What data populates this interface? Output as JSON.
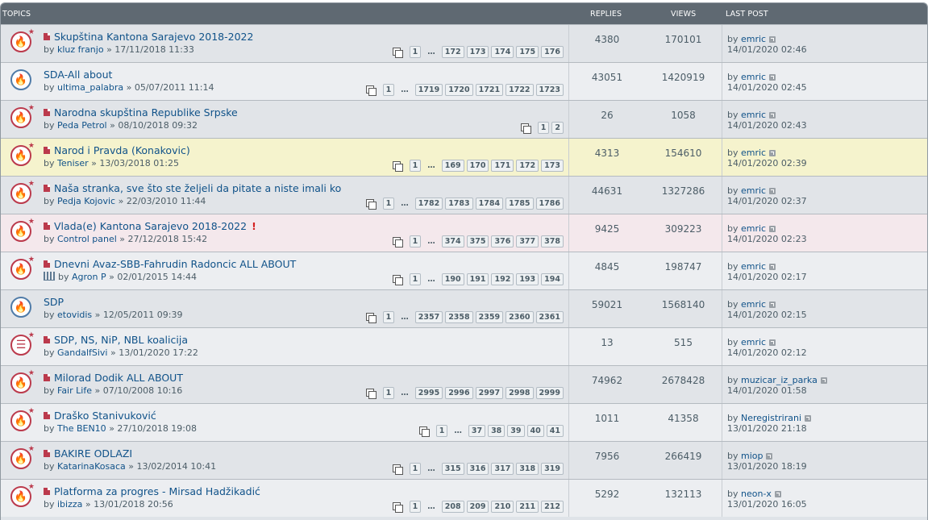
{
  "header": {
    "topics": "TOPICS",
    "replies": "REPLIES",
    "views": "VIEWS",
    "last_post": "LAST POST"
  },
  "topics": [
    {
      "title": "Skupština Kantona Sarajevo 2018-2022",
      "by": "by",
      "author": "kluz franjo",
      "date": "» 17/11/2018 11:33",
      "replies": "4380",
      "views": "170101",
      "last_by": "by",
      "last_author": "emric",
      "last_date": "14/01/2020 02:46",
      "pages": [
        "1",
        "…",
        "172",
        "173",
        "174",
        "175",
        "176"
      ],
      "icon": "hot-unread-icon",
      "state": "normal",
      "marker": true
    },
    {
      "title": "SDA-All about",
      "by": "by",
      "author": "ultima_palabra",
      "date": "» 05/07/2011 11:14",
      "replies": "43051",
      "views": "1420919",
      "last_by": "by",
      "last_author": "emric",
      "last_date": "14/01/2020 02:45",
      "pages": [
        "1",
        "…",
        "1719",
        "1720",
        "1721",
        "1722",
        "1723"
      ],
      "icon": "hot-read-icon",
      "state": "alt",
      "marker": false
    },
    {
      "title": "Narodna skupština Republike Srpske",
      "by": "by",
      "author": "Peda Petrol",
      "date": "» 08/10/2018 09:32",
      "replies": "26",
      "views": "1058",
      "last_by": "by",
      "last_author": "emric",
      "last_date": "14/01/2020 02:43",
      "pages": [
        "1",
        "2"
      ],
      "icon": "hot-unread-icon",
      "state": "normal",
      "marker": true
    },
    {
      "title": "Narod i Pravda (Konakovic)",
      "by": "by",
      "author": "Teniser",
      "date": "» 13/03/2018 01:25",
      "replies": "4313",
      "views": "154610",
      "last_by": "by",
      "last_author": "emric",
      "last_date": "14/01/2020 02:39",
      "pages": [
        "1",
        "…",
        "169",
        "170",
        "171",
        "172",
        "173"
      ],
      "icon": "hot-unread-icon",
      "state": "sticky",
      "marker": true
    },
    {
      "title": "Naša stranka, sve što ste željeli da pitate a niste imali ko",
      "by": "by",
      "author": "Pedja Kojovic",
      "date": "» 22/03/2010 11:44",
      "replies": "44631",
      "views": "1327286",
      "last_by": "by",
      "last_author": "emric",
      "last_date": "14/01/2020 02:37",
      "pages": [
        "1",
        "…",
        "1782",
        "1783",
        "1784",
        "1785",
        "1786"
      ],
      "icon": "hot-unread-icon",
      "state": "normal",
      "marker": true
    },
    {
      "title": "Vlada(e) Kantona Sarajevo 2018-2022",
      "by": "by",
      "author": "Control panel",
      "date": "» 27/12/2018 15:42",
      "replies": "9425",
      "views": "309223",
      "last_by": "by",
      "last_author": "emric",
      "last_date": "14/01/2020 02:23",
      "pages": [
        "1",
        "…",
        "374",
        "375",
        "376",
        "377",
        "378"
      ],
      "icon": "hot-unread-icon",
      "state": "reported",
      "marker": true,
      "reported_mark": "!"
    },
    {
      "title": "Dnevni Avaz-SBB-Fahrudin Radoncic ALL ABOUT",
      "by": "by",
      "author": "Agron P",
      "date": "» 02/01/2015 14:44",
      "replies": "4845",
      "views": "198747",
      "last_by": "by",
      "last_author": "emric",
      "last_date": "14/01/2020 02:17",
      "pages": [
        "1",
        "…",
        "190",
        "191",
        "192",
        "193",
        "194"
      ],
      "icon": "hot-unread-icon",
      "state": "alt",
      "marker": true,
      "poll": true
    },
    {
      "title": "SDP",
      "by": "by",
      "author": "etovidis",
      "date": "» 12/05/2011 09:39",
      "replies": "59021",
      "views": "1568140",
      "last_by": "by",
      "last_author": "emric",
      "last_date": "14/01/2020 02:15",
      "pages": [
        "1",
        "…",
        "2357",
        "2358",
        "2359",
        "2360",
        "2361"
      ],
      "icon": "hot-read-icon",
      "state": "normal",
      "marker": false
    },
    {
      "title": "SDP, NS, NiP, NBL koalicija",
      "by": "by",
      "author": "GandalfSivi",
      "date": "» 13/01/2020 17:22",
      "replies": "13",
      "views": "515",
      "last_by": "by",
      "last_author": "emric",
      "last_date": "14/01/2020 02:12",
      "pages": [],
      "icon": "topic-unread-icon",
      "state": "alt",
      "marker": true
    },
    {
      "title": "Milorad Dodik ALL ABOUT",
      "by": "by",
      "author": "Fair Life",
      "date": "» 07/10/2008 10:16",
      "replies": "74962",
      "views": "2678428",
      "last_by": "by",
      "last_author": "muzicar_iz_parka",
      "last_date": "14/01/2020 01:58",
      "pages": [
        "1",
        "…",
        "2995",
        "2996",
        "2997",
        "2998",
        "2999"
      ],
      "icon": "hot-unread-icon",
      "state": "normal",
      "marker": true
    },
    {
      "title": "Draško Stanivuković",
      "by": "by",
      "author": "The BEN10",
      "date": "» 27/10/2018 19:08",
      "replies": "1011",
      "views": "41358",
      "last_by": "by",
      "last_author": "Neregistrirani",
      "last_date": "13/01/2020 21:18",
      "pages": [
        "1",
        "…",
        "37",
        "38",
        "39",
        "40",
        "41"
      ],
      "icon": "hot-unread-icon",
      "state": "alt",
      "marker": true
    },
    {
      "title": "BAKIRE ODLAZI",
      "by": "by",
      "author": "KatarinaKosaca",
      "date": "» 13/02/2014 10:41",
      "replies": "7956",
      "views": "266419",
      "last_by": "by",
      "last_author": "miop",
      "last_date": "13/01/2020 18:19",
      "pages": [
        "1",
        "…",
        "315",
        "316",
        "317",
        "318",
        "319"
      ],
      "icon": "hot-unread-icon",
      "state": "normal",
      "marker": true
    },
    {
      "title": "Platforma za progres - Mirsad Hadžikadić",
      "by": "by",
      "author": "ibizza",
      "date": "» 13/01/2018 20:56",
      "replies": "5292",
      "views": "132113",
      "last_by": "by",
      "last_author": "neon-x",
      "last_date": "13/01/2020 16:05",
      "pages": [
        "1",
        "…",
        "208",
        "209",
        "210",
        "211",
        "212"
      ],
      "icon": "hot-unread-icon",
      "state": "alt",
      "marker": true
    }
  ],
  "colors": {
    "header_bg": "#5f6972",
    "link": "#105289",
    "hot_icon": "#bb3a4c",
    "read_icon": "#4f7ba8",
    "sticky_bg": "#f5f3cd",
    "reported_bg": "#f4e8ec"
  }
}
